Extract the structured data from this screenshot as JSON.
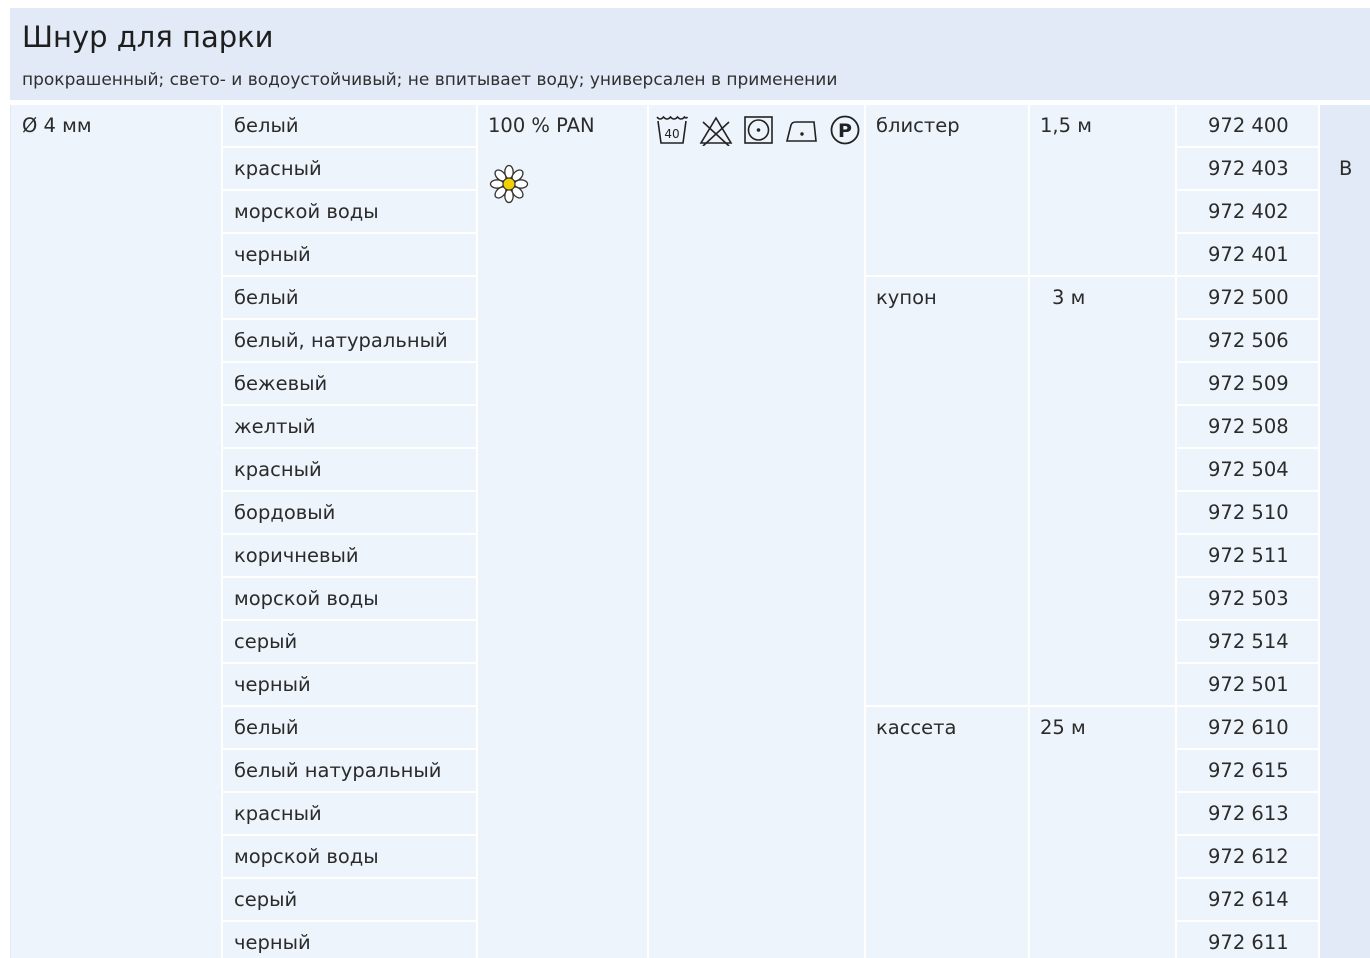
{
  "header": {
    "title": "Шнур для парки",
    "subtitle": "прокрашенный; свето- и водоустойчивый; не впитывает воду; универсален в применении"
  },
  "product": {
    "size": "Ø 4 мм",
    "material": "100 % PAN",
    "material_icon": "daisy-icon",
    "care_icons": [
      "wash-40-icon",
      "no-bleach-icon",
      "tumble-dry-low-icon",
      "iron-low-icon",
      "dry-clean-p-icon"
    ],
    "mark": "B"
  },
  "groups": [
    {
      "packaging": "блистер",
      "length": "1,5 м",
      "items": [
        {
          "color": "белый",
          "article": "972 400"
        },
        {
          "color": "красный",
          "article": "972 403"
        },
        {
          "color": "морской воды",
          "article": "972 402"
        },
        {
          "color": "черный",
          "article": "972 401"
        }
      ]
    },
    {
      "packaging": "купон",
      "length": "3 м",
      "items": [
        {
          "color": "белый",
          "article": "972 500"
        },
        {
          "color": "белый, натуральный",
          "article": "972 506"
        },
        {
          "color": "бежевый",
          "article": "972 509"
        },
        {
          "color": "желтый",
          "article": "972 508"
        },
        {
          "color": "красный",
          "article": "972 504"
        },
        {
          "color": "бордовый",
          "article": "972 510"
        },
        {
          "color": "коричневый",
          "article": "972 511"
        },
        {
          "color": "морской воды",
          "article": "972 503"
        },
        {
          "color": "серый",
          "article": "972 514"
        },
        {
          "color": "черный",
          "article": "972 501"
        }
      ]
    },
    {
      "packaging": "кассета",
      "length": "25 м",
      "items": [
        {
          "color": "белый",
          "article": "972 610"
        },
        {
          "color": "белый натуральный",
          "article": "972 615"
        },
        {
          "color": "красный",
          "article": "972 613"
        },
        {
          "color": "морской воды",
          "article": "972 612"
        },
        {
          "color": "серый",
          "article": "972 614"
        },
        {
          "color": "черный",
          "article": "972 611"
        }
      ]
    }
  ],
  "colors": {
    "header_bg": "#e1eaf6",
    "cell_bg": "#eef4fb",
    "text": "#2b2b2b",
    "flower_center": "#f5d000"
  }
}
